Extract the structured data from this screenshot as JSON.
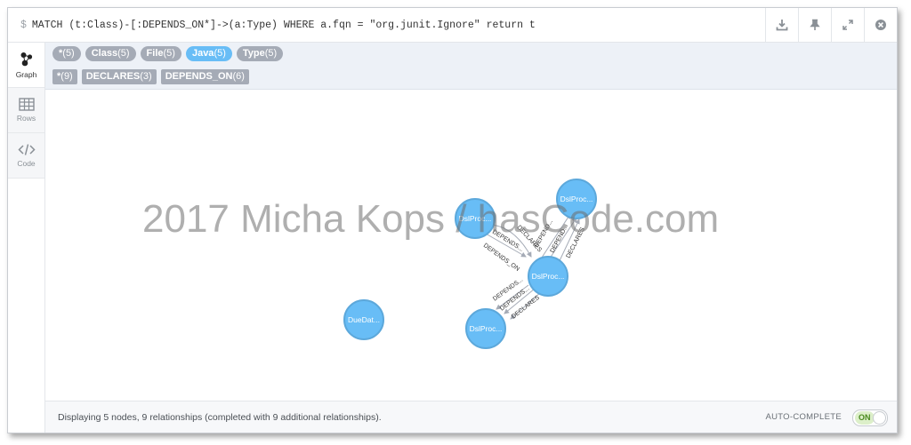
{
  "query": {
    "prompt": "$",
    "text": "MATCH (t:Class)-[:DEPENDS_ON*]->(a:Type) WHERE a.fqn = \"org.junit.Ignore\" return t",
    "actions": [
      "download-icon",
      "pin-icon",
      "expand-icon",
      "close-icon"
    ]
  },
  "sidebar": {
    "items": [
      {
        "label": "Graph",
        "icon": "graph-icon",
        "active": true
      },
      {
        "label": "Rows",
        "icon": "table-icon",
        "active": false
      },
      {
        "label": "Code",
        "icon": "code-icon",
        "active": false
      }
    ]
  },
  "node_labels": [
    {
      "name": "*",
      "count": "(5)"
    },
    {
      "name": "Class",
      "count": "(5)"
    },
    {
      "name": "File",
      "count": "(5)"
    },
    {
      "name": "Java",
      "count": "(5)"
    },
    {
      "name": "Type",
      "count": "(5)"
    }
  ],
  "rel_types": [
    {
      "name": "*",
      "count": "(9)"
    },
    {
      "name": "DECLARES",
      "count": "(3)"
    },
    {
      "name": "DEPENDS_ON",
      "count": "(6)"
    }
  ],
  "graph": {
    "nodes": [
      {
        "id": "n1",
        "caption": "DslProc..."
      },
      {
        "id": "n2",
        "caption": "DslProc..."
      },
      {
        "id": "n3",
        "caption": "DslProc..."
      },
      {
        "id": "n4",
        "caption": "DslProc..."
      },
      {
        "id": "n5",
        "caption": "DueDat..."
      }
    ],
    "edge_labels": {
      "depends": "DEPENDS...",
      "depends_on": "DEPENDS_ON",
      "declares": "DECLARES",
      "declares_short": "DECLARES",
      "depends_short": "DEPEND..."
    },
    "node_color": "#68bdf6",
    "node_stroke": "#5ca8db"
  },
  "status": {
    "text": "Displaying 5 nodes, 9 relationships (completed with 9 additional relationships).",
    "autocomplete_label": "AUTO-COMPLETE",
    "toggle_label": "ON"
  },
  "watermark": "2017 Micha Kops / hasCode.com"
}
